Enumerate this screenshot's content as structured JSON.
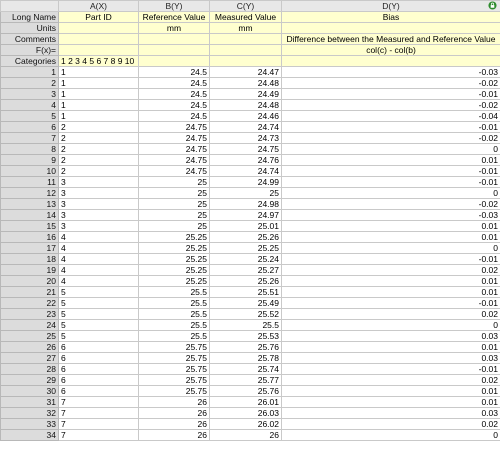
{
  "columns": [
    {
      "name": "A(X)"
    },
    {
      "name": "B(Y)"
    },
    {
      "name": "C(Y)"
    },
    {
      "name": "D(Y)"
    }
  ],
  "meta_rows": {
    "long_name": {
      "label": "Long Name",
      "values": [
        "Part ID",
        "Reference Value",
        "Measured Value",
        "Bias"
      ]
    },
    "units": {
      "label": "Units",
      "values": [
        "",
        "mm",
        "mm",
        ""
      ]
    },
    "comments": {
      "label": "Comments",
      "values": [
        "",
        "",
        "",
        "Difference between the Measured and Reference Value"
      ]
    },
    "fx": {
      "label": "F(x)=",
      "values": [
        "",
        "",
        "",
        "col(c) - col(b)"
      ]
    },
    "categories": {
      "label": "Categories",
      "values": [
        "1 2 3 4 5 6 7 8 9 10",
        "",
        "",
        ""
      ]
    }
  },
  "rows": [
    {
      "n": "1",
      "a": "1",
      "b": "24.5",
      "c": "24.47",
      "d": "-0.03"
    },
    {
      "n": "2",
      "a": "1",
      "b": "24.5",
      "c": "24.48",
      "d": "-0.02"
    },
    {
      "n": "3",
      "a": "1",
      "b": "24.5",
      "c": "24.49",
      "d": "-0.01"
    },
    {
      "n": "4",
      "a": "1",
      "b": "24.5",
      "c": "24.48",
      "d": "-0.02"
    },
    {
      "n": "5",
      "a": "1",
      "b": "24.5",
      "c": "24.46",
      "d": "-0.04"
    },
    {
      "n": "6",
      "a": "2",
      "b": "24.75",
      "c": "24.74",
      "d": "-0.01"
    },
    {
      "n": "7",
      "a": "2",
      "b": "24.75",
      "c": "24.73",
      "d": "-0.02"
    },
    {
      "n": "8",
      "a": "2",
      "b": "24.75",
      "c": "24.75",
      "d": "0"
    },
    {
      "n": "9",
      "a": "2",
      "b": "24.75",
      "c": "24.76",
      "d": "0.01"
    },
    {
      "n": "10",
      "a": "2",
      "b": "24.75",
      "c": "24.74",
      "d": "-0.01"
    },
    {
      "n": "11",
      "a": "3",
      "b": "25",
      "c": "24.99",
      "d": "-0.01"
    },
    {
      "n": "12",
      "a": "3",
      "b": "25",
      "c": "25",
      "d": "0"
    },
    {
      "n": "13",
      "a": "3",
      "b": "25",
      "c": "24.98",
      "d": "-0.02"
    },
    {
      "n": "14",
      "a": "3",
      "b": "25",
      "c": "24.97",
      "d": "-0.03"
    },
    {
      "n": "15",
      "a": "3",
      "b": "25",
      "c": "25.01",
      "d": "0.01"
    },
    {
      "n": "16",
      "a": "4",
      "b": "25.25",
      "c": "25.26",
      "d": "0.01"
    },
    {
      "n": "17",
      "a": "4",
      "b": "25.25",
      "c": "25.25",
      "d": "0"
    },
    {
      "n": "18",
      "a": "4",
      "b": "25.25",
      "c": "25.24",
      "d": "-0.01"
    },
    {
      "n": "19",
      "a": "4",
      "b": "25.25",
      "c": "25.27",
      "d": "0.02"
    },
    {
      "n": "20",
      "a": "4",
      "b": "25.25",
      "c": "25.26",
      "d": "0.01"
    },
    {
      "n": "21",
      "a": "5",
      "b": "25.5",
      "c": "25.51",
      "d": "0.01"
    },
    {
      "n": "22",
      "a": "5",
      "b": "25.5",
      "c": "25.49",
      "d": "-0.01"
    },
    {
      "n": "23",
      "a": "5",
      "b": "25.5",
      "c": "25.52",
      "d": "0.02"
    },
    {
      "n": "24",
      "a": "5",
      "b": "25.5",
      "c": "25.5",
      "d": "0"
    },
    {
      "n": "25",
      "a": "5",
      "b": "25.5",
      "c": "25.53",
      "d": "0.03"
    },
    {
      "n": "26",
      "a": "6",
      "b": "25.75",
      "c": "25.76",
      "d": "0.01"
    },
    {
      "n": "27",
      "a": "6",
      "b": "25.75",
      "c": "25.78",
      "d": "0.03"
    },
    {
      "n": "28",
      "a": "6",
      "b": "25.75",
      "c": "25.74",
      "d": "-0.01"
    },
    {
      "n": "29",
      "a": "6",
      "b": "25.75",
      "c": "25.77",
      "d": "0.02"
    },
    {
      "n": "30",
      "a": "6",
      "b": "25.75",
      "c": "25.76",
      "d": "0.01"
    },
    {
      "n": "31",
      "a": "7",
      "b": "26",
      "c": "26.01",
      "d": "0.01"
    },
    {
      "n": "32",
      "a": "7",
      "b": "26",
      "c": "26.03",
      "d": "0.03"
    },
    {
      "n": "33",
      "a": "7",
      "b": "26",
      "c": "26.02",
      "d": "0.02"
    },
    {
      "n": "34",
      "a": "7",
      "b": "26",
      "c": "26",
      "d": "0"
    }
  ],
  "colors": {
    "meta_bg": "#ffffcf",
    "header_bg": "#e8e8e8",
    "row_header_bg": "#dcdcdc",
    "grid_line": "#c9c9c9"
  },
  "icons": {
    "header_d": "lock-icon"
  }
}
